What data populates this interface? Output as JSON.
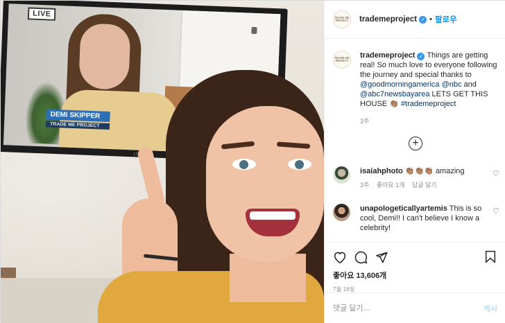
{
  "photo": {
    "tv_badge": "LIVE",
    "tv_name": "DEMI SKIPPER",
    "tv_subtitle": "TRADE ME PROJECT",
    "tv_brand": "LG"
  },
  "header": {
    "avatar_text": "TRADE ME PROJECT",
    "username": "trademeproject",
    "separator": "•",
    "follow_label": "팔로우"
  },
  "caption": {
    "username": "trademeproject",
    "text_1": " Things are getting real! So much love to everyone following the journey and special thanks to ",
    "mention_1": "@goodmorningamerica",
    "space_1": " ",
    "mention_2": "@nbc",
    "text_2": " and ",
    "mention_3": "@abc7newsbayarea",
    "text_3": " LETS GET THIS HOUSE 👏🏽 ",
    "hashtag": "#trademeproject",
    "time": "3주"
  },
  "comments": [
    {
      "username": "isaiahphoto",
      "text": " 👏🏽👏🏽👏🏽 amazing",
      "time": "3주",
      "likes": "좋아요 1개",
      "reply": "답글 달기"
    },
    {
      "username": "unapologeticallyartemis",
      "text": " This is so cool, Demi!! I can't believe I know a celebrity!",
      "time": "",
      "likes": "",
      "reply": ""
    }
  ],
  "actions": {
    "likes": "좋아요 13,606개",
    "date": "7월 16일"
  },
  "add_comment": {
    "placeholder": "댓글 달기...",
    "post_label": "게시"
  },
  "colors": {
    "accent": "#0095f6",
    "verified": "#3897f0",
    "muted": "#8e8e8e",
    "post_disabled": "#b2dffc"
  }
}
